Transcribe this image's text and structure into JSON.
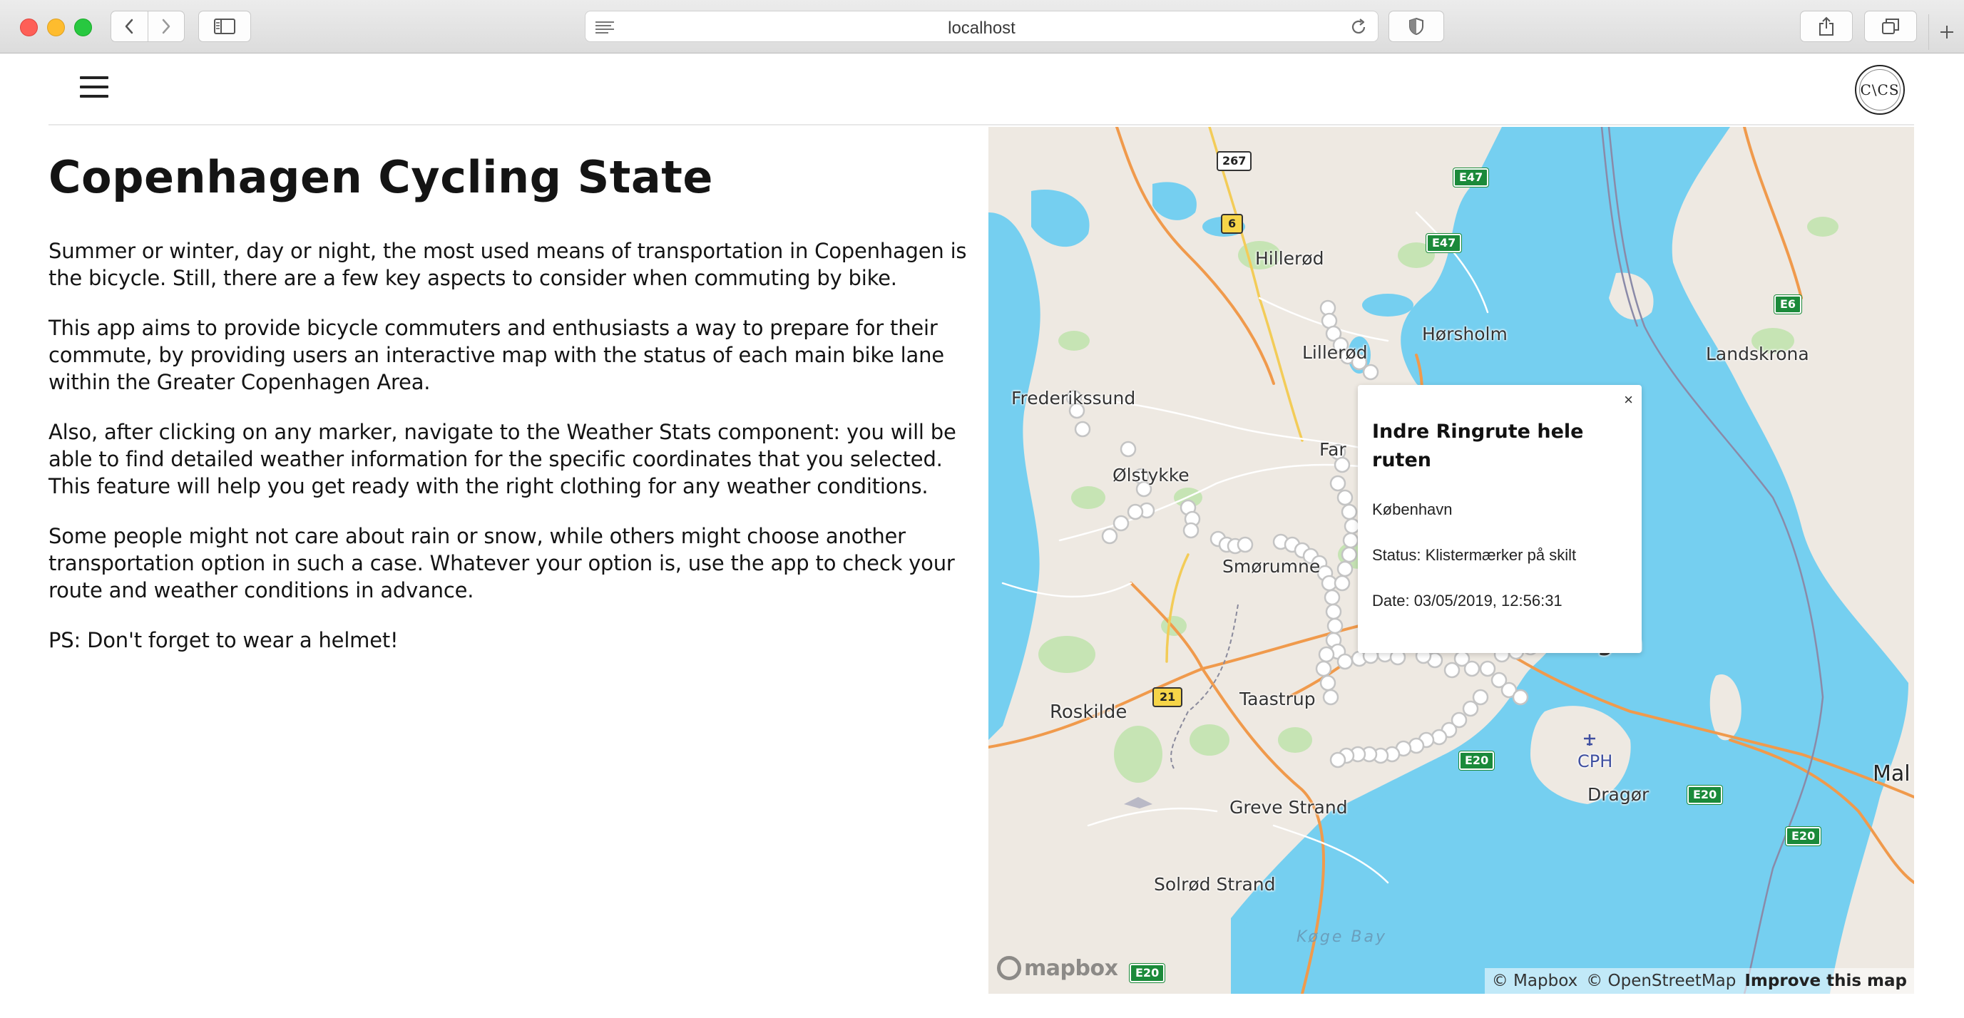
{
  "browser": {
    "url": "localhost"
  },
  "header": {
    "logo_text": "C\\CS"
  },
  "main": {
    "title": "Copenhagen Cycling State",
    "paragraphs": [
      "Summer or winter, day or night, the most used means of transportation in Copenhagen is the bicycle. Still, there are a few key aspects to consider when commuting by bike.",
      "This app aims to provide bicycle commuters and enthusiasts a way to prepare for their commute, by providing users an interactive map with the status of each main bike lane within the Greater Copenhagen Area.",
      "Also, after clicking on any marker, navigate to the Weather Stats component: you will be able to find detailed weather information for the specific coordinates that you selected. This feature will help you get ready with the right clothing for any weather conditions.",
      "Some people might not care about rain or snow, while others might choose another transportation option in such a case. Whatever your option is, use the app to check your route and weather conditions in advance.",
      "PS: Don't forget to wear a helmet!"
    ]
  },
  "map": {
    "labels": {
      "hillerod": "Hillerød",
      "horsholm": "Hørsholm",
      "landskrona": "Landskrona",
      "frederikssund": "Frederikssund",
      "lillerod": "Lillerød",
      "farum": "Far",
      "olstykke": "Ølstykke",
      "smorumnedre": "Smørumne",
      "roskilde": "Roskilde",
      "taastrup": "Taastrup",
      "cph": "CPH",
      "dragor": "Dragør",
      "malmo": "Mal",
      "greve": "Greve Strand",
      "solrod": "Solrød Strand",
      "koge_bay": "Køge Bay",
      "city_partial": "gen"
    },
    "shields": {
      "r267": "267",
      "r6": "6",
      "r21": "21",
      "e47a": "E47",
      "e47b": "E47",
      "e6": "E6",
      "e20a": "E20",
      "e20b": "E20",
      "e20c": "E20",
      "e20d": "E20"
    },
    "popup": {
      "close": "×",
      "title": "Indre Ringrute hele ruten",
      "city": "København",
      "status": "Status: Klistermærker på skilt",
      "date": "Date: 03/05/2019, 12:56:31"
    },
    "mapbox_logo": "mapbox",
    "attribution": {
      "mapbox": "© Mapbox",
      "osm": "© OpenStreetMap",
      "improve": "Improve this map"
    }
  }
}
